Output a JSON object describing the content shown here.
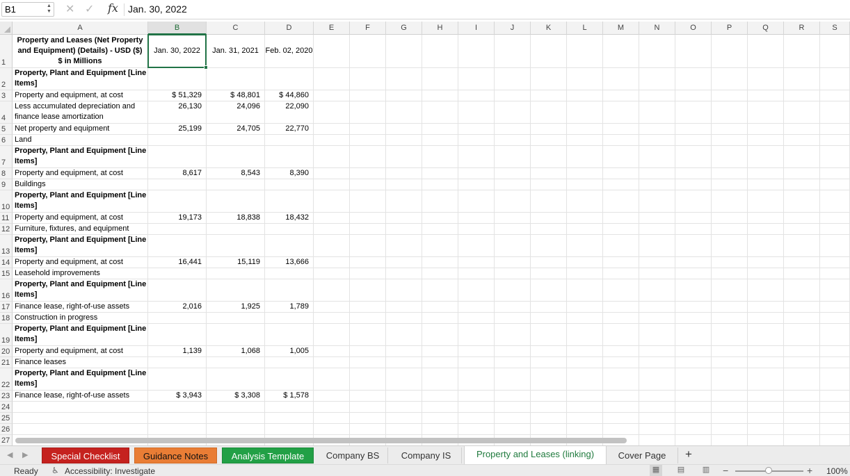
{
  "formula_bar": {
    "name_box": "B1",
    "fx_label": "fx",
    "formula": "Jan. 30, 2022"
  },
  "columns": [
    "A",
    "B",
    "C",
    "D",
    "E",
    "F",
    "G",
    "H",
    "I",
    "J",
    "K",
    "L",
    "M",
    "N",
    "O",
    "P",
    "Q",
    "R",
    "S"
  ],
  "selected_column": "B",
  "rows": [
    {
      "num": "1",
      "a": "Property and Leases (Net Property and Equipment) (Details) - USD ($) $ in Millions",
      "b": "Jan. 30, 2022",
      "c": "Jan. 31, 2021",
      "d": "Feb. 02, 2020"
    },
    {
      "num": "2",
      "a": "Property, Plant and Equipment [Line Items]",
      "b": "",
      "c": "",
      "d": ""
    },
    {
      "num": "3",
      "a": "Property and equipment, at cost",
      "b": "$ 51,329",
      "c": "$ 48,801",
      "d": "$ 44,860"
    },
    {
      "num": "4",
      "a": "Less accumulated depreciation and finance lease amortization",
      "b": "26,130",
      "c": "24,096",
      "d": "22,090"
    },
    {
      "num": "5",
      "a": "Net property and equipment",
      "b": "25,199",
      "c": "24,705",
      "d": "22,770"
    },
    {
      "num": "6",
      "a": "Land",
      "b": "",
      "c": "",
      "d": ""
    },
    {
      "num": "7",
      "a": "Property, Plant and Equipment [Line Items]",
      "b": "",
      "c": "",
      "d": ""
    },
    {
      "num": "8",
      "a": "Property and equipment, at cost",
      "b": "8,617",
      "c": "8,543",
      "d": "8,390"
    },
    {
      "num": "9",
      "a": "Buildings",
      "b": "",
      "c": "",
      "d": ""
    },
    {
      "num": "10",
      "a": "Property, Plant and Equipment [Line Items]",
      "b": "",
      "c": "",
      "d": ""
    },
    {
      "num": "11",
      "a": "Property and equipment, at cost",
      "b": "19,173",
      "c": "18,838",
      "d": "18,432"
    },
    {
      "num": "12",
      "a": "Furniture, fixtures, and equipment",
      "b": "",
      "c": "",
      "d": ""
    },
    {
      "num": "13",
      "a": "Property, Plant and Equipment [Line Items]",
      "b": "",
      "c": "",
      "d": ""
    },
    {
      "num": "14",
      "a": "Property and equipment, at cost",
      "b": "16,441",
      "c": "15,119",
      "d": "13,666"
    },
    {
      "num": "15",
      "a": "Leasehold improvements",
      "b": "",
      "c": "",
      "d": ""
    },
    {
      "num": "16",
      "a": "Property, Plant and Equipment [Line Items]",
      "b": "",
      "c": "",
      "d": ""
    },
    {
      "num": "17",
      "a": "Finance lease, right-of-use assets",
      "b": "2,016",
      "c": "1,925",
      "d": "1,789"
    },
    {
      "num": "18",
      "a": "Construction in progress",
      "b": "",
      "c": "",
      "d": ""
    },
    {
      "num": "19",
      "a": "Property, Plant and Equipment [Line Items]",
      "b": "",
      "c": "",
      "d": ""
    },
    {
      "num": "20",
      "a": "Property and equipment, at cost",
      "b": "1,139",
      "c": "1,068",
      "d": "1,005"
    },
    {
      "num": "21",
      "a": "Finance leases",
      "b": "",
      "c": "",
      "d": ""
    },
    {
      "num": "22",
      "a": "Property, Plant and Equipment [Line Items]",
      "b": "",
      "c": "",
      "d": ""
    },
    {
      "num": "23",
      "a": "Finance lease, right-of-use assets",
      "b": "$ 3,943",
      "c": "$ 3,308",
      "d": "$ 1,578"
    },
    {
      "num": "24",
      "a": "",
      "b": "",
      "c": "",
      "d": ""
    },
    {
      "num": "25",
      "a": "",
      "b": "",
      "c": "",
      "d": ""
    },
    {
      "num": "26",
      "a": "",
      "b": "",
      "c": "",
      "d": ""
    },
    {
      "num": "27",
      "a": "",
      "b": "",
      "c": "",
      "d": ""
    }
  ],
  "sheet_tabs": [
    {
      "label": "Special Checklist",
      "style": "red"
    },
    {
      "label": "Guidance Notes",
      "style": "orange"
    },
    {
      "label": "Analysis Template",
      "style": "green"
    },
    {
      "label": "Company BS",
      "style": "plain"
    },
    {
      "label": "Company IS",
      "style": "plain"
    },
    {
      "label": "Property and Leases (linking)",
      "style": "active"
    },
    {
      "label": "Cover Page",
      "style": "plain"
    }
  ],
  "add_sheet": "+",
  "status": {
    "ready": "Ready",
    "accessibility": "Accessibility: Investigate",
    "zoom": "100%",
    "zoom_minus": "−",
    "zoom_plus": "+"
  },
  "icons": {
    "cancel": "close-icon",
    "confirm": "check-icon",
    "accessibility": "accessibility-icon"
  },
  "colors": {
    "accent": "#217346",
    "tab_red": "#c5221f",
    "tab_orange": "#e97d35",
    "tab_green": "#22a046"
  }
}
